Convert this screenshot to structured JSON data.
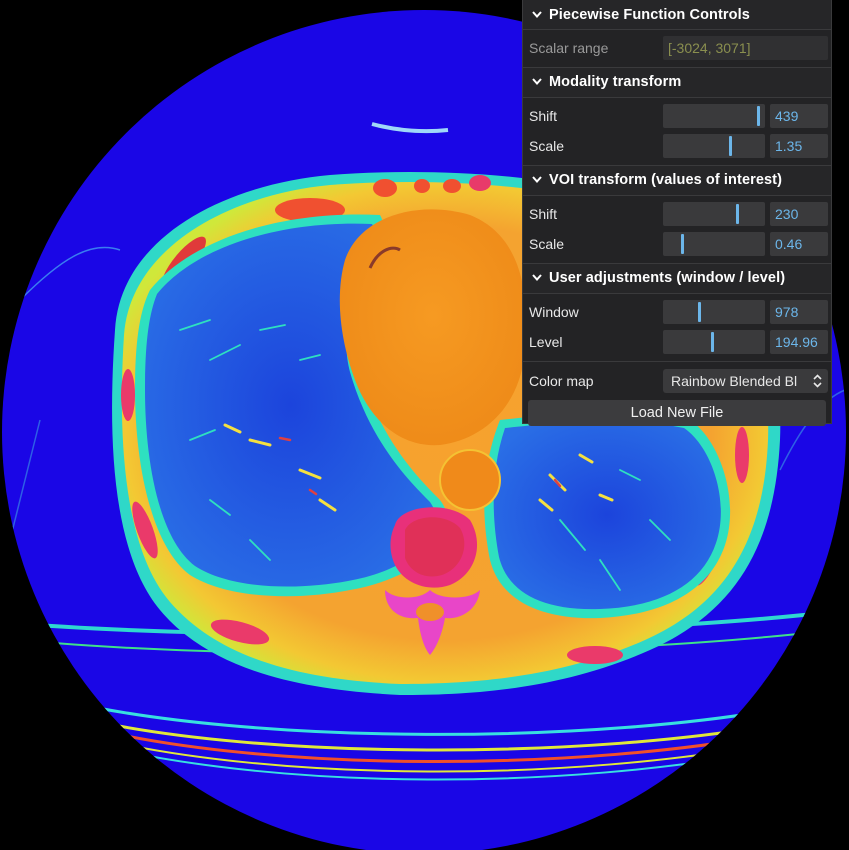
{
  "panel": {
    "title": "Piecewise Function Controls",
    "scalar_range": {
      "label": "Scalar range",
      "value": "[-3024, 3071]"
    },
    "modality": {
      "title": "Modality transform",
      "shift": {
        "label": "Shift",
        "value": "439",
        "position": 0.93
      },
      "scale": {
        "label": "Scale",
        "value": "1.35",
        "position": 0.66
      }
    },
    "voi": {
      "title": "VOI transform (values of interest)",
      "shift": {
        "label": "Shift",
        "value": "230",
        "position": 0.73
      },
      "scale": {
        "label": "Scale",
        "value": "0.46",
        "position": 0.19
      }
    },
    "user": {
      "title": "User adjustments (window / level)",
      "window": {
        "label": "Window",
        "value": "978",
        "position": 0.35
      },
      "level": {
        "label": "Level",
        "value": "194.96",
        "position": 0.48
      }
    },
    "color_map": {
      "label": "Color map",
      "value": "Rainbow Blended Bl"
    },
    "load_button": "Load New File"
  },
  "colors": {
    "accent": "#6cb6ea",
    "panel_bg": "#232325",
    "field_bg": "#3a3a3c",
    "scan_outer": "#1a06e6",
    "scan_tissue": "#f0902a",
    "scan_lung": "#1e3fd8"
  },
  "icons": {
    "section_toggle": "chevron-down-icon",
    "select_arrows": "up-down-arrows-icon"
  }
}
